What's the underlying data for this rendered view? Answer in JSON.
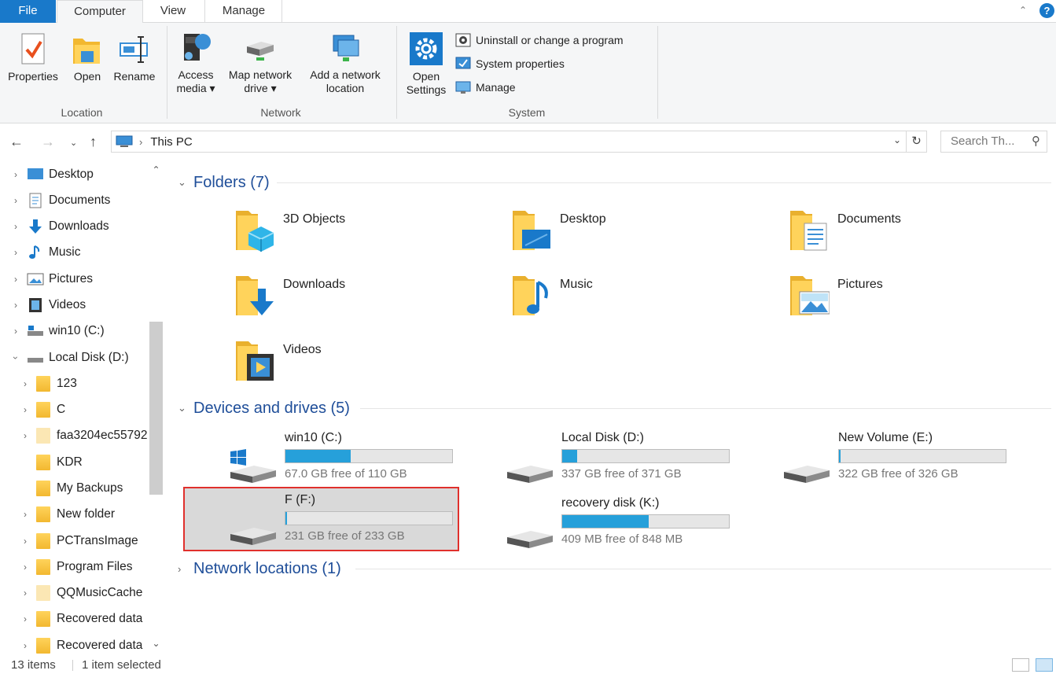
{
  "tabs": {
    "file": "File",
    "computer": "Computer",
    "view": "View",
    "manage": "Manage"
  },
  "ribbon": {
    "location": {
      "label": "Location",
      "properties": "Properties",
      "open": "Open",
      "rename": "Rename"
    },
    "network": {
      "label": "Network",
      "access_media_1": "Access",
      "access_media_2": "media ▾",
      "map_drive_1": "Map network",
      "map_drive_2": "drive ▾",
      "add_location_1": "Add a network",
      "add_location_2": "location"
    },
    "system": {
      "label": "System",
      "open_settings_1": "Open",
      "open_settings_2": "Settings",
      "uninstall": "Uninstall or change a program",
      "sys_props": "System properties",
      "manage": "Manage"
    }
  },
  "address": {
    "crumb": "This PC",
    "search_placeholder": "Search Th..."
  },
  "navpane": {
    "items": [
      {
        "label": "Desktop",
        "icon": "desktop-icon"
      },
      {
        "label": "Documents",
        "icon": "documents-icon"
      },
      {
        "label": "Downloads",
        "icon": "downloads-icon"
      },
      {
        "label": "Music",
        "icon": "music-icon"
      },
      {
        "label": "Pictures",
        "icon": "pictures-icon"
      },
      {
        "label": "Videos",
        "icon": "videos-icon"
      },
      {
        "label": "win10 (C:)",
        "icon": "drive-icon"
      },
      {
        "label": "Local Disk (D:)",
        "icon": "drive-icon"
      }
    ],
    "subfolders": [
      "123",
      "C",
      "faa3204ec55792",
      "KDR",
      "My Backups",
      "New folder",
      "PCTransImage",
      "Program Files",
      "QQMusicCache",
      "Recovered data",
      "Recovered data"
    ]
  },
  "sections": {
    "folders": "Folders (7)",
    "devices": "Devices and drives (5)",
    "network": "Network locations (1)"
  },
  "folders": [
    {
      "name": "3D Objects"
    },
    {
      "name": "Desktop"
    },
    {
      "name": "Documents"
    },
    {
      "name": "Downloads"
    },
    {
      "name": "Music"
    },
    {
      "name": "Pictures"
    },
    {
      "name": "Videos"
    }
  ],
  "drives": [
    {
      "name": "win10 (C:)",
      "free": "67.0 GB free of 110 GB",
      "used_fraction": 0.39
    },
    {
      "name": "Local Disk (D:)",
      "free": "337 GB free of 371 GB",
      "used_fraction": 0.09
    },
    {
      "name": "New Volume (E:)",
      "free": "322 GB free of 326 GB",
      "used_fraction": 0.01
    },
    {
      "name": "F (F:)",
      "free": "231 GB free of 233 GB",
      "used_fraction": 0.01
    },
    {
      "name": "recovery disk (K:)",
      "free": "409 MB free of 848 MB",
      "used_fraction": 0.52
    }
  ],
  "status": {
    "items": "13 items",
    "selected": "1 item selected"
  },
  "colors": {
    "accent": "#1979ca",
    "drive_bar": "#26a0da",
    "selection_outline": "#e0302c"
  }
}
